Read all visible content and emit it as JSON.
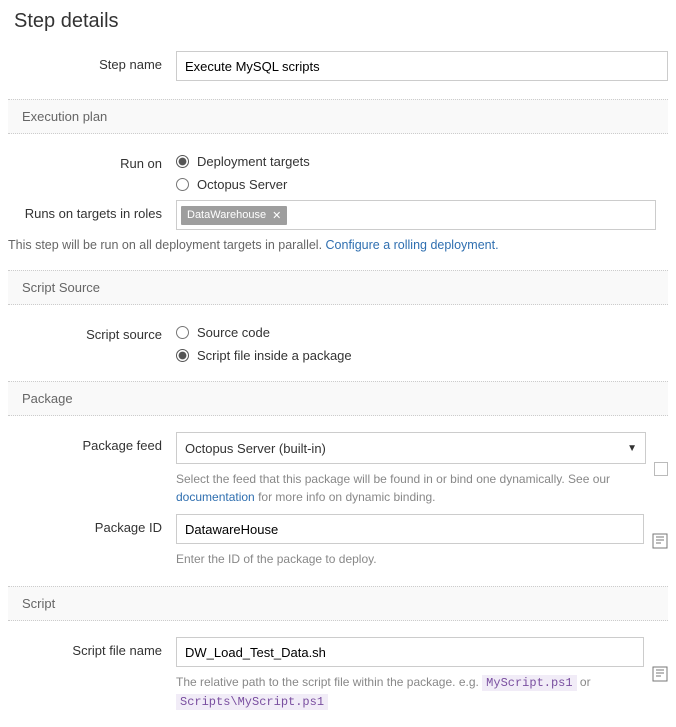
{
  "pageTitle": "Step details",
  "stepName": {
    "label": "Step name",
    "value": "Execute MySQL scripts"
  },
  "sections": {
    "executionPlan": "Execution plan",
    "scriptSource": "Script Source",
    "package": "Package",
    "script": "Script"
  },
  "runOn": {
    "label": "Run on",
    "options": {
      "targets": "Deployment targets",
      "server": "Octopus Server"
    },
    "selected": "targets"
  },
  "roles": {
    "label": "Runs on targets in roles",
    "tags": [
      "DataWarehouse"
    ]
  },
  "parallelNote": {
    "text": "This step will be run on all deployment targets in parallel. ",
    "linkText": "Configure a rolling deployment."
  },
  "scriptSource": {
    "label": "Script source",
    "options": {
      "code": "Source code",
      "package": "Script file inside a package"
    },
    "selected": "package"
  },
  "packageFeed": {
    "label": "Package feed",
    "value": "Octopus Server (built-in)",
    "helperPrefix": "Select the feed that this package will be found in or bind one dynamically. See our ",
    "helperLink": "documentation",
    "helperSuffix": " for more info on dynamic binding."
  },
  "packageId": {
    "label": "Package ID",
    "value": "DatawareHouse",
    "helper": "Enter the ID of the package to deploy."
  },
  "scriptFile": {
    "label": "Script file name",
    "value": "DW_Load_Test_Data.sh",
    "helperPrefix": "The relative path to the script file within the package. e.g. ",
    "code1": "MyScript.ps1",
    "or": " or ",
    "code2": "Scripts\\MyScript.ps1"
  }
}
